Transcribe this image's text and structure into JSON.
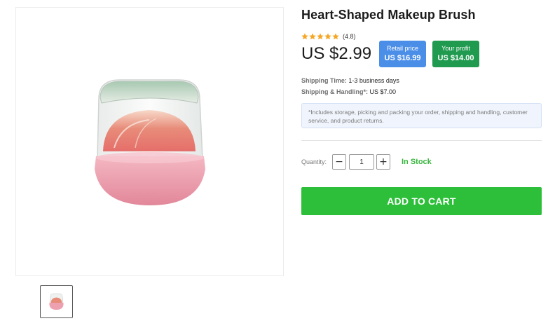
{
  "product": {
    "title": "Heart-Shaped Makeup Brush",
    "rating_text": "(4.8)",
    "rating_value": 4.8,
    "rating_max": 5,
    "price": "US $2.99"
  },
  "pricing": {
    "retail_label": "Retail price",
    "retail_value": "US $16.99",
    "profit_label": "Your profit",
    "profit_value": "US $14.00"
  },
  "shipping": {
    "time_label": "Shipping Time:",
    "time_value": "1-3 business days",
    "handling_label": "Shipping & Handling*:",
    "handling_value": "US $7.00",
    "notice": "*Includes storage, picking and packing your order, shipping and handling, customer service, and product returns."
  },
  "quantity": {
    "label": "Quantity:",
    "value": "1",
    "decrement": "−",
    "increment": "+"
  },
  "stock_status": "In Stock",
  "cart_button": "ADD TO CART",
  "colors": {
    "star": "#f5a623",
    "retail_badge": "#4b8ee8",
    "profit_badge": "#1f9a4f",
    "in_stock": "#3ab540",
    "cart_button": "#2dbf3a"
  },
  "icons": {
    "star": "star-icon"
  }
}
